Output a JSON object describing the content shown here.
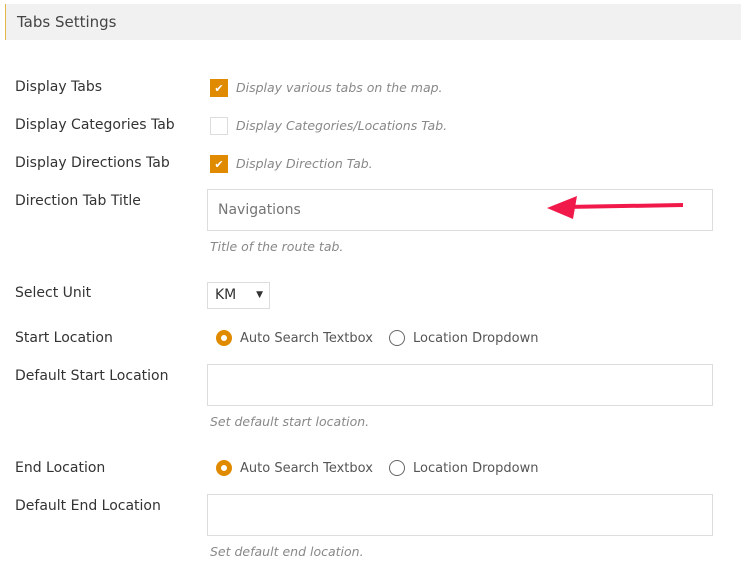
{
  "header": {
    "title": "Tabs Settings"
  },
  "fields": {
    "display_tabs": {
      "label": "Display Tabs",
      "checked": true,
      "description": "Display various tabs on the map."
    },
    "display_categories": {
      "label": "Display Categories Tab",
      "checked": false,
      "description": "Display Categories/Locations Tab."
    },
    "display_directions": {
      "label": "Display Directions Tab",
      "checked": true,
      "description": "Display Direction Tab."
    },
    "direction_title": {
      "label": "Direction Tab Title",
      "placeholder": "Navigations",
      "help": "Title of the route tab."
    },
    "unit": {
      "label": "Select Unit",
      "value": "KM"
    },
    "start_location": {
      "label": "Start Location",
      "options": [
        "Auto Search Textbox",
        "Location Dropdown"
      ],
      "selected": "Auto Search Textbox"
    },
    "default_start": {
      "label": "Default Start Location",
      "value": "",
      "help": "Set default start location."
    },
    "end_location": {
      "label": "End Location",
      "options": [
        "Auto Search Textbox",
        "Location Dropdown"
      ],
      "selected": "Auto Search Textbox"
    },
    "default_end": {
      "label": "Default End Location",
      "value": "",
      "help": "Set default end location."
    }
  },
  "colors": {
    "accent": "#e08a00",
    "annotation_arrow": "#f0194a"
  }
}
